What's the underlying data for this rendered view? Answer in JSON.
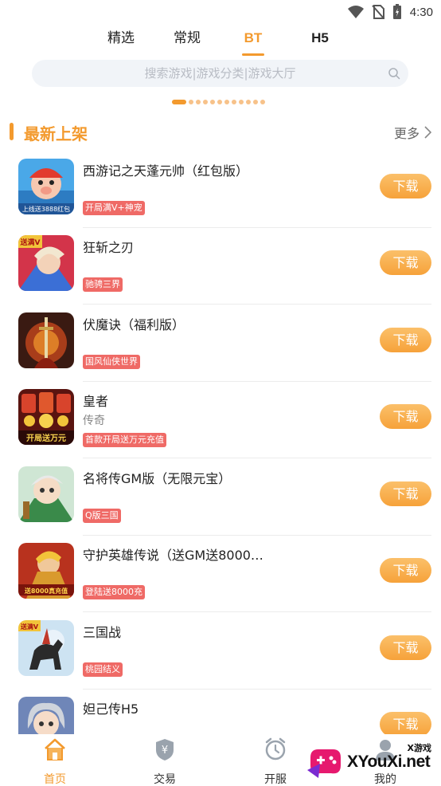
{
  "status_bar": {
    "time": "4:30"
  },
  "top_tabs": [
    {
      "label": "精选",
      "active": false
    },
    {
      "label": "常规",
      "active": false
    },
    {
      "label": "BT",
      "active": true
    },
    {
      "label": "H5",
      "active": false
    }
  ],
  "search": {
    "placeholder": "搜索游戏|游戏分类|游戏大厅"
  },
  "pager": {
    "count": 12,
    "active_index": 0
  },
  "section": {
    "title": "最新上架",
    "more_label": "更多"
  },
  "download_label": "下载",
  "games": [
    {
      "name": "西游记之天蓬元帅（红包版）",
      "subtitle": "",
      "tag": "开局满V+神宠",
      "icon": "pig-hero-icon"
    },
    {
      "name": "狂斩之刃",
      "subtitle": "",
      "tag": "驰骋三界",
      "icon": "warrior-icon"
    },
    {
      "name": "伏魔诀（福利版）",
      "subtitle": "",
      "tag": "国风仙侠世界",
      "icon": "flame-sword-icon"
    },
    {
      "name": "皇者",
      "subtitle": "传奇",
      "tag": "首款开局送万元充值",
      "icon": "gold-coins-icon"
    },
    {
      "name": "名将传GM版（无限元宝）",
      "subtitle": "",
      "tag": "Q版三国",
      "icon": "general-icon"
    },
    {
      "name": "守护英雄传说（送GM送8000…",
      "subtitle": "",
      "tag": "登陆送8000充",
      "icon": "knight-icon"
    },
    {
      "name": "三国战",
      "subtitle": "",
      "tag": "桃园结义",
      "icon": "cavalry-icon"
    },
    {
      "name": "妲己传H5",
      "subtitle": "",
      "tag": "",
      "icon": "daji-icon"
    }
  ],
  "icon_text": {
    "game1": "上线送3888红包",
    "game2": "送满V",
    "game4_badge": "开局送万元",
    "game6": "送8000真充值",
    "game7": "送满V"
  },
  "bottom_nav": [
    {
      "label": "首页",
      "icon": "home-icon",
      "active": true
    },
    {
      "label": "交易",
      "icon": "yen-shield-icon",
      "active": false
    },
    {
      "label": "开服",
      "icon": "alarm-clock-icon",
      "active": false
    },
    {
      "label": "我的",
      "icon": "profile-icon",
      "active": false
    }
  ],
  "watermark": {
    "small": "X游戏",
    "main": "XYouXi.net"
  },
  "colors": {
    "accent": "#f39a2e",
    "tag_bg": "#ef6a66",
    "search_bg": "#f1f4f8"
  }
}
